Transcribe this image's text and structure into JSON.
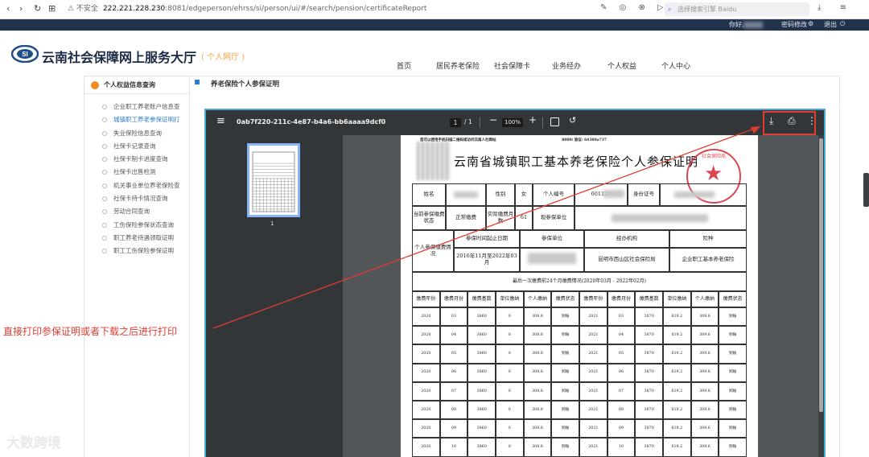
{
  "browser": {
    "nav_icons": [
      "‹",
      "›",
      "↻",
      "⊞"
    ],
    "security": "⚠ 不安全",
    "host": "222.221.228.230",
    "path": ":8081/edgeperson/ehrss/si/person/ui/#/search/pension/certificateReport",
    "search_placeholder": "选择搜索引擎 Baidu",
    "tool_icons": "✎ ◎ ⊗ ▷ ♡",
    "right_icons": "⤓ ≡"
  },
  "site": {
    "greeting": "你好,",
    "pwd_change": "密码修改",
    "logout": "退出",
    "title": "云南社会保障网上服务大厅",
    "tag": "( 个人网厅 )",
    "logo_text": "SI",
    "nav": [
      "首页",
      "居民养老保险",
      "社会保障卡",
      "业务经办",
      "个人权益",
      "个人中心"
    ]
  },
  "sidebar": {
    "heading": "个人权益信息查询",
    "items": [
      "企业职工养老账户信息查",
      "城镇职工养老参保证明打",
      "失业保险信息查询",
      "社保卡记录查询",
      "社保卡制卡进度查询",
      "社保卡出售检测",
      "机关事业单位养老保险查",
      "社保卡持卡情况查询",
      "劳动合同查询",
      "工伤保险参保状态查询",
      "职工养老待遇领取证明",
      "职工工伤保险参保证明"
    ],
    "active_index": 1
  },
  "main": {
    "title": "养老保险个人参保证明"
  },
  "viewer": {
    "filename": "0ab7f220-211c-4e87-b4a6-bb6aaaa9dcf0",
    "page_current": "1",
    "page_total": "/ 1",
    "zoom": "100%",
    "thumb_number": "1",
    "icons": {
      "menu": "hamburger-icon",
      "download": "download-icon",
      "print": "print-icon",
      "more": "more-vert-icon",
      "fit": "fit-page-icon",
      "rotate": "rotate-icon"
    }
  },
  "document": {
    "note": "您可以使用手机扫描二维码或访问云南人社网站",
    "note_right": "8080/    验证:       64380a737",
    "title": "云南省城镇职工基本养老保险个人参保证明",
    "seal_text": "社会保险局",
    "row1": {
      "name_label": "姓名",
      "sex_label": "性别",
      "sex": "女",
      "pid_label": "个人编号",
      "pid_partial": "601129",
      "idcard_label": "身份证号"
    },
    "row2": {
      "status_label": "当前参保缴费状态",
      "status": "正常缴费",
      "months_label": "实际缴费月数",
      "months": "61",
      "unit_label": "现参保单位"
    },
    "row3": {
      "group_label": "个人参保缴费情况",
      "period_label": "参保时间起止日期",
      "unit_label": "参保单位",
      "agency_label": "经办机构",
      "type_label": "险种",
      "period": "2016年11月至2022年03月",
      "agency": "昆明市西山区社会保险局",
      "type": "企业职工基本养老保险"
    },
    "section_title": "最后一次缴费前24个月缴费情况(2020年03月 - 2022年02月)",
    "columns": [
      "缴费年份",
      "缴费月份",
      "缴费基数",
      "单位缴纳",
      "个人缴纳",
      "缴费状态",
      "缴费年份",
      "缴费月份",
      "缴费基数",
      "单位缴纳",
      "个人缴纳",
      "缴费状态"
    ],
    "rows": [
      [
        "2020",
        "03",
        "3860",
        "0",
        "308.8",
        "到账",
        "2021",
        "03",
        "3870",
        "619.2",
        "309.6",
        "到账"
      ],
      [
        "2020",
        "04",
        "3860",
        "0",
        "308.8",
        "到账",
        "2021",
        "04",
        "3870",
        "619.2",
        "309.6",
        "到账"
      ],
      [
        "2020",
        "05",
        "3860",
        "0",
        "308.8",
        "到账",
        "2021",
        "05",
        "3870",
        "619.2",
        "309.6",
        "到账"
      ],
      [
        "2020",
        "06",
        "3860",
        "0",
        "308.8",
        "到账",
        "2021",
        "06",
        "3870",
        "619.2",
        "309.6",
        "到账"
      ],
      [
        "2020",
        "07",
        "3860",
        "0",
        "308.8",
        "到账",
        "2021",
        "07",
        "3870",
        "619.2",
        "309.6",
        "到账"
      ],
      [
        "2020",
        "08",
        "3860",
        "0",
        "308.8",
        "到账",
        "2021",
        "08",
        "3870",
        "619.2",
        "309.6",
        "到账"
      ],
      [
        "2020",
        "09",
        "3860",
        "0",
        "308.8",
        "到账",
        "2021",
        "09",
        "3870",
        "619.2",
        "309.6",
        "到账"
      ],
      [
        "2020",
        "10",
        "3860",
        "0",
        "308.8",
        "到账",
        "2021",
        "10",
        "3870",
        "619.2",
        "309.6",
        "到账"
      ]
    ]
  },
  "annotation": {
    "text": "直接打印参保证明或者下载之后进行打印",
    "color": "#e03c31"
  },
  "watermark": "大数跨境"
}
